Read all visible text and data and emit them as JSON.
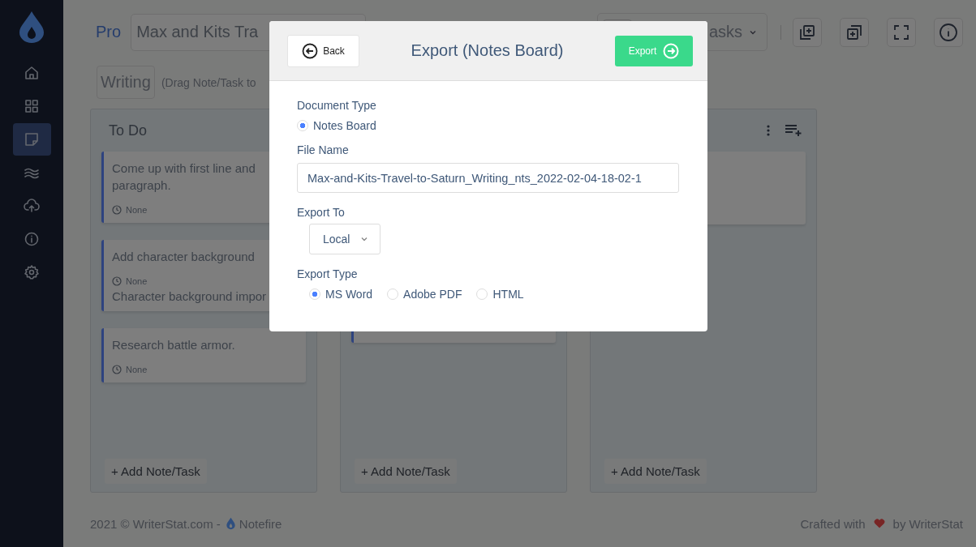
{
  "sidebar": {
    "items": [
      {
        "kind": "home",
        "selected": false
      },
      {
        "kind": "grid",
        "selected": false
      },
      {
        "kind": "note",
        "selected": true
      },
      {
        "kind": "waves",
        "selected": false
      },
      {
        "kind": "upload",
        "selected": false
      },
      {
        "kind": "info",
        "selected": false
      },
      {
        "kind": "settings",
        "selected": false
      }
    ]
  },
  "header": {
    "plan": "Pro",
    "project_title": "Max and Kits Tra",
    "view_select": "asks"
  },
  "board": {
    "name": "Writing",
    "hint": "(Drag Note/Task to"
  },
  "columns": [
    {
      "title": "To Do",
      "add_button": "+ Add Note/Task",
      "cards": [
        {
          "kind": "note",
          "title": "Come up with first line and paragraph.",
          "due": "None"
        },
        {
          "kind": "note",
          "title": "Add character background",
          "due": "None",
          "note": "Character background impor"
        },
        {
          "kind": "note",
          "title": "Research battle armor.",
          "due": "None"
        }
      ]
    },
    {
      "add_button": "+ Add Note/Task",
      "cards": [
        {
          "kind": "covered"
        }
      ]
    },
    {
      "show_actions": true,
      "add_button": "+ Add Note/Task",
      "cards": [
        {
          "kind": "blank"
        }
      ]
    }
  ],
  "dialog": {
    "title": "Export (Notes Board)",
    "back_button": "Back",
    "export_button": "Export",
    "document_type": {
      "label": "Document Type",
      "options": [
        {
          "label": "Notes Board",
          "selected": true
        }
      ]
    },
    "file_name": {
      "label": "File Name",
      "value": "Max-and-Kits-Travel-to-Saturn_Writing_nts_2022-02-04-18-02-1"
    },
    "export_to": {
      "label": "Export To",
      "value": "Local"
    },
    "export_type": {
      "label": "Export Type",
      "options": [
        {
          "label": "MS Word",
          "selected": true
        },
        {
          "label": "Adobe PDF",
          "selected": false
        },
        {
          "label": "HTML",
          "selected": false
        }
      ]
    }
  },
  "footer": {
    "copyright": "2021 ©  WriterStat.com -",
    "brand": "Notefire",
    "crafted": "Crafted with",
    "by": "by WriterStat"
  }
}
